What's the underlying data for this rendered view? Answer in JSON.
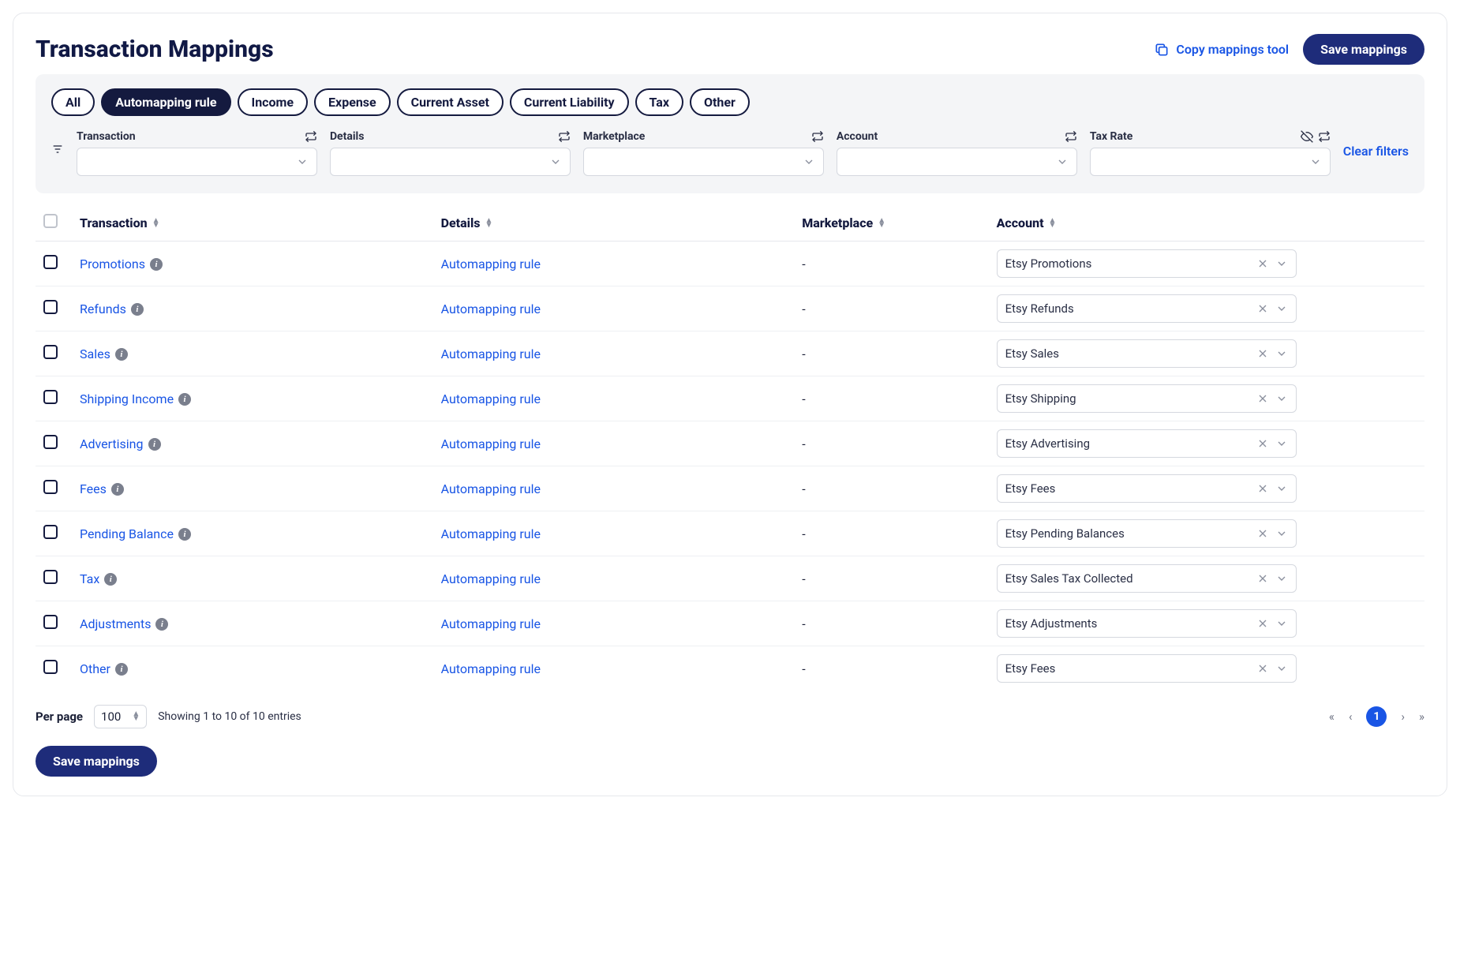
{
  "title": "Transaction Mappings",
  "copy_tool": "Copy mappings tool",
  "save_label": "Save mappings",
  "pills": [
    {
      "label": "All",
      "active": false
    },
    {
      "label": "Automapping rule",
      "active": true
    },
    {
      "label": "Income",
      "active": false
    },
    {
      "label": "Expense",
      "active": false
    },
    {
      "label": "Current Asset",
      "active": false
    },
    {
      "label": "Current Liability",
      "active": false
    },
    {
      "label": "Tax",
      "active": false
    },
    {
      "label": "Other",
      "active": false
    }
  ],
  "filters": {
    "transaction": "Transaction",
    "details": "Details",
    "marketplace": "Marketplace",
    "account": "Account",
    "tax_rate": "Tax Rate",
    "clear": "Clear filters"
  },
  "columns": {
    "transaction": "Transaction",
    "details": "Details",
    "marketplace": "Marketplace",
    "account": "Account"
  },
  "rows": [
    {
      "transaction": "Promotions",
      "details": "Automapping rule",
      "marketplace": "-",
      "account": "Etsy Promotions"
    },
    {
      "transaction": "Refunds",
      "details": "Automapping rule",
      "marketplace": "-",
      "account": "Etsy Refunds"
    },
    {
      "transaction": "Sales",
      "details": "Automapping rule",
      "marketplace": "-",
      "account": "Etsy Sales"
    },
    {
      "transaction": "Shipping Income",
      "details": "Automapping rule",
      "marketplace": "-",
      "account": "Etsy Shipping"
    },
    {
      "transaction": "Advertising",
      "details": "Automapping rule",
      "marketplace": "-",
      "account": "Etsy Advertising"
    },
    {
      "transaction": "Fees",
      "details": "Automapping rule",
      "marketplace": "-",
      "account": "Etsy Fees"
    },
    {
      "transaction": "Pending Balance",
      "details": "Automapping rule",
      "marketplace": "-",
      "account": "Etsy Pending Balances"
    },
    {
      "transaction": "Tax",
      "details": "Automapping rule",
      "marketplace": "-",
      "account": "Etsy Sales Tax Collected"
    },
    {
      "transaction": "Adjustments",
      "details": "Automapping rule",
      "marketplace": "-",
      "account": "Etsy Adjustments"
    },
    {
      "transaction": "Other",
      "details": "Automapping rule",
      "marketplace": "-",
      "account": "Etsy Fees"
    }
  ],
  "footer": {
    "per_page_label": "Per page",
    "per_page_value": "100",
    "entries": "Showing 1 to 10 of 10 entries",
    "page": "1"
  }
}
